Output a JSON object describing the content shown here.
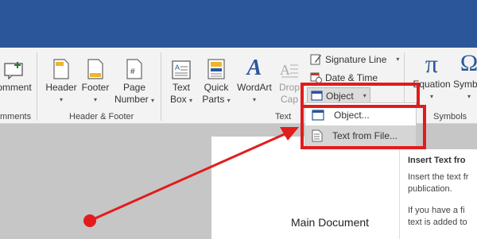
{
  "ribbon": {
    "comment_label": "omment",
    "comments_group": "mments",
    "header_label": "Header",
    "footer_label": "Footer",
    "page_number_line1": "Page",
    "page_number_line2": "Number",
    "header_footer_group": "Header & Footer",
    "text_box_line1": "Text",
    "text_box_line2": "Box",
    "quick_parts_line1": "Quick",
    "quick_parts_line2": "Parts",
    "wordart_label": "WordArt",
    "drop_cap_line1": "Drop",
    "drop_cap_line2": "Cap",
    "text_group": "Text",
    "signature_line": "Signature Line",
    "date_time": "Date & Time",
    "object": "Object",
    "equation": "Equation",
    "symbol": "Symbol",
    "symbols_group": "Symbols",
    "pi_glyph": "π",
    "omega_glyph": "Ω"
  },
  "object_menu": {
    "items": [
      {
        "label": "Object..."
      },
      {
        "label": "Text from File..."
      }
    ]
  },
  "document": {
    "heading": "Main Document"
  },
  "tooltip": {
    "title": "Insert Text fro",
    "body": "Insert the text fr publication.",
    "body2": "If you have a fi text is added to"
  },
  "colors": {
    "title_bar": "#2b579a",
    "highlight": "#e21c1c",
    "accent": "#2b579a"
  }
}
